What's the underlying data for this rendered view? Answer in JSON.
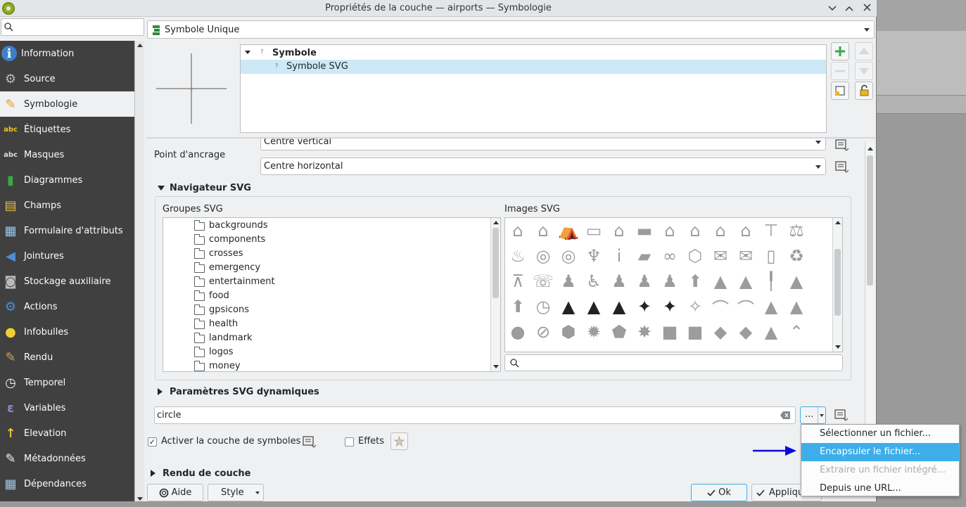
{
  "window": {
    "title": "Propriétés de la couche — airports — Symbologie",
    "controls": [
      "chevron-down",
      "chevron-up",
      "close"
    ]
  },
  "search": {
    "placeholder": ""
  },
  "sidebar": {
    "items": [
      {
        "label": "Information",
        "icon": "information-icon"
      },
      {
        "label": "Source",
        "icon": "source-icon"
      },
      {
        "label": "Symbologie",
        "icon": "symbology-icon",
        "active": true
      },
      {
        "label": "Étiquettes",
        "icon": "labels-icon"
      },
      {
        "label": "Masques",
        "icon": "masks-icon"
      },
      {
        "label": "Diagrammes",
        "icon": "diagrams-icon"
      },
      {
        "label": "Champs",
        "icon": "fields-icon"
      },
      {
        "label": "Formulaire d'attributs",
        "icon": "attributes-form-icon"
      },
      {
        "label": "Jointures",
        "icon": "joins-icon"
      },
      {
        "label": "Stockage auxiliaire",
        "icon": "auxiliary-storage-icon"
      },
      {
        "label": "Actions",
        "icon": "actions-icon"
      },
      {
        "label": "Infobulles",
        "icon": "tooltips-icon"
      },
      {
        "label": "Rendu",
        "icon": "rendering-icon"
      },
      {
        "label": "Temporel",
        "icon": "temporal-icon"
      },
      {
        "label": "Variables",
        "icon": "variables-icon"
      },
      {
        "label": "Elevation",
        "icon": "elevation-icon"
      },
      {
        "label": "Métadonnées",
        "icon": "metadata-icon"
      },
      {
        "label": "Dépendances",
        "icon": "dependencies-icon"
      }
    ]
  },
  "renderer": {
    "selected": "Symbole Unique"
  },
  "symbol_tree": {
    "root": "Symbole",
    "child": "Symbole SVG"
  },
  "anchor": {
    "label": "Point d'ancrage",
    "vertical": "Centre vertical",
    "horizontal": "Centre horizontal"
  },
  "svg_browser": {
    "header": "Navigateur SVG",
    "groups_label": "Groupes SVG",
    "images_label": "Images SVG",
    "groups": [
      "backgrounds",
      "components",
      "crosses",
      "emergency",
      "entertainment",
      "food",
      "gpsicons",
      "health",
      "landmark",
      "logos",
      "money"
    ],
    "image_search_placeholder": ""
  },
  "dynamic_params": {
    "header": "Paramètres SVG dynamiques"
  },
  "svg_path": {
    "value": "circle",
    "browse_label": "..."
  },
  "symbol_layer": {
    "enable_label": "Activer la couche de symboles",
    "enable_checked": true,
    "effects_label": "Effets",
    "effects_checked": false
  },
  "layer_render": {
    "header": "Rendu de couche"
  },
  "buttons": {
    "help": "Aide",
    "style": "Style",
    "ok": "Ok",
    "apply": "Appliquer"
  },
  "file_menu": {
    "items": [
      {
        "label": "Sélectionner un fichier...",
        "state": "normal"
      },
      {
        "label": "Encapsuler le fichier...",
        "state": "highlighted"
      },
      {
        "label": "Extraire un fichier intégré...",
        "state": "disabled"
      },
      {
        "label": "Depuis une URL...",
        "state": "normal"
      }
    ]
  },
  "colors": {
    "sidebar_bg": "#404040",
    "highlight": "#3daee9",
    "selected_row": "#cde8f6",
    "annotation_arrow": "#0a0ad6"
  }
}
